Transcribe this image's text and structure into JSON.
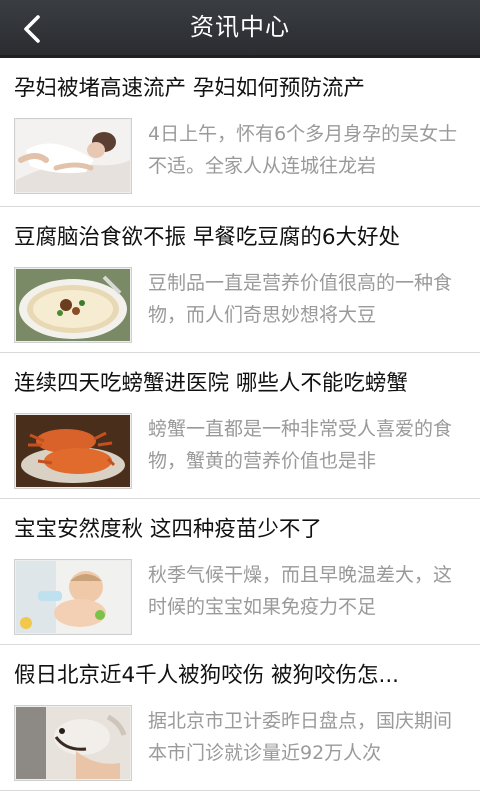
{
  "header": {
    "title": "资讯中心",
    "back_icon": "chevron-left-icon"
  },
  "colors": {
    "header_bg": "#2f3135",
    "headline": "#111111",
    "summary": "#9a9a9a",
    "divider": "#d9d9d9"
  },
  "news": [
    {
      "headline": "孕妇被堵高速流产 孕妇如何预防流产",
      "summary": "4日上午，怀有6个多月身孕的吴女士不适。全家人从连城往龙岩",
      "image": "pregnant-woman-photo"
    },
    {
      "headline": "豆腐脑治食欲不振 早餐吃豆腐的6大好处",
      "summary": "豆制品一直是营养价值很高的一种食物，而人们奇思妙想将大豆",
      "image": "tofu-pudding-photo"
    },
    {
      "headline": "连续四天吃螃蟹进医院 哪些人不能吃螃蟹",
      "summary": "螃蟹一直都是一种非常受人喜爱的食物，蟹黄的营养价值也是非",
      "image": "crabs-photo"
    },
    {
      "headline": "宝宝安然度秋 这四种疫苗少不了",
      "summary": "秋季气候干燥，而且早晚温差大，这时候的宝宝如果免疫力不足",
      "image": "baby-photo"
    },
    {
      "headline": "假日北京近4千人被狗咬伤 被狗咬伤怎...",
      "summary": "据北京市卫计委昨日盘点，国庆期间本市门诊就诊量近92万人次",
      "image": "dog-bite-photo"
    }
  ]
}
